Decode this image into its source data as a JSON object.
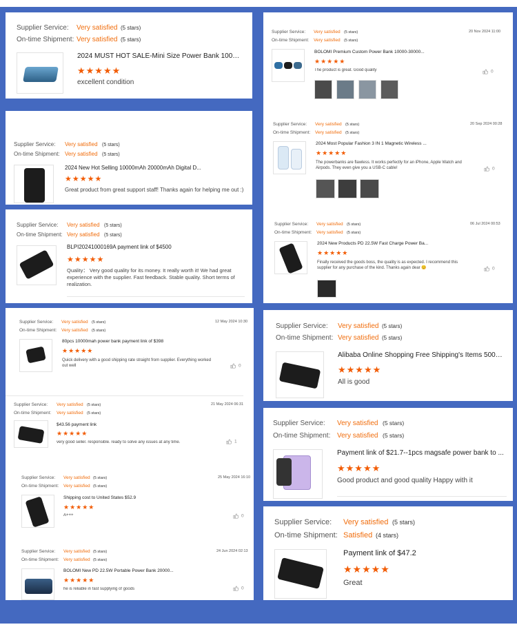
{
  "labels": {
    "supplier": "Supplier Service:",
    "ontime": "On-time Shipment:"
  },
  "colors": {
    "background": "#4469c0",
    "accent": "#f06c0b",
    "star": "#f25c05"
  },
  "reviews": [
    {
      "supplier_val": "Very satisfied",
      "supplier_cnt": "(5 stars)",
      "ontime_val": "Very satisfied",
      "ontime_cnt": "(5 stars)",
      "date": "",
      "product": "2024 MUST HOT SALE-Mini Size Power Bank 10000 ...",
      "rating": 5,
      "text": "excellent condition",
      "likes": ""
    },
    {
      "supplier_val": "Very satisfied",
      "supplier_cnt": "(5 stars)",
      "ontime_val": "Very satisfied",
      "ontime_cnt": "(5 stars)",
      "date": "",
      "product": "2024 New Hot Selling 10000mAh 20000mAh Digital D...",
      "rating": 5,
      "text": "Great product from great support staff! Thanks again for helping me out :)",
      "likes": ""
    },
    {
      "supplier_val": "Very satisfied",
      "supplier_cnt": "(5 stars)",
      "ontime_val": "Very satisfied",
      "ontime_cnt": "(5 stars)",
      "date": "",
      "product": "BLPI20241000169A payment link of $4500",
      "rating": 5,
      "text": "Quality：  Very good quality for its money. It really worth it! We had great experience with the supplier. Fast feedback. Stable quality. Short terms of realization.",
      "likes": ""
    },
    {
      "supplier_val": "Very satisfied",
      "supplier_cnt": "(5 stars)",
      "ontime_val": "Very satisfied",
      "ontime_cnt": "(5 stars)",
      "date": "12 May 2024 10:30",
      "product": "80pcs 10000mah power bank payment link of $398",
      "rating": 5,
      "text": "Quick delivery with a good shipping rate straight from supplier. Everything worked out well",
      "likes": "0"
    },
    {
      "supplier_val": "Very satisfied",
      "supplier_cnt": "(5 stars)",
      "ontime_val": "Very satisfied",
      "ontime_cnt": "(5 stars)",
      "date": "21 May 2024 06:31",
      "product": "$43.56 payment link",
      "rating": 5,
      "text": "very good seller.  responsible.  ready to solve any issues at any time.",
      "likes": "1"
    },
    {
      "supplier_val": "Very satisfied",
      "supplier_cnt": "(5 stars)",
      "ontime_val": "Very satisfied",
      "ontime_cnt": "(5 stars)",
      "date": "25 May 2024 16:10",
      "product": "Shipping cost to United States $52.9",
      "rating": 5,
      "text": "A+++",
      "likes": "0"
    },
    {
      "supplier_val": "Very satisfied",
      "supplier_cnt": "(5 stars)",
      "ontime_val": "Very satisfied",
      "ontime_cnt": "(5 stars)",
      "date": "24 Jun 2024 02:13",
      "product": "BOLOMI New PD 22.5W Portable Power Bank 20000...",
      "rating": 5,
      "text": "he is reliable in fast supplying of goods",
      "likes": "0"
    },
    {
      "supplier_val": "Very satisfied",
      "supplier_cnt": "(5 stars)",
      "ontime_val": "Very satisfied",
      "ontime_cnt": "(5 stars)",
      "date": "20 Nov 2024 11:00",
      "product": "BOLOMI Premium Custom Power Bank 10000-30000...",
      "rating": 5,
      "text": "The product is great. Good quality",
      "likes": "0"
    },
    {
      "supplier_val": "Very satisfied",
      "supplier_cnt": "(5 stars)",
      "ontime_val": "Very satisfied",
      "ontime_cnt": "(5 stars)",
      "date": "20 Sep 2024 00:28",
      "product": "2024 Most Popular Fashion 3 IN 1 Magnetic Wireless ...",
      "rating": 5,
      "text": "The powerbanks are flawless. It works perfectly for an iPhone, Apple Watch and Airpods. They even give you a USB-C cable!",
      "likes": "0"
    },
    {
      "supplier_val": "Very satisfied",
      "supplier_cnt": "(5 stars)",
      "ontime_val": "Very satisfied",
      "ontime_cnt": "(5 stars)",
      "date": "06 Jul 2024 00:53",
      "product": "2024 New Products PD 22.5W Fast Charge Power Ba...",
      "rating": 5,
      "text": "Finally received the goods boss, the quality is as expected. I recommend this supplier for any purchase of the kind. Thanks again dear 😊",
      "likes": "0"
    },
    {
      "supplier_val": "Very satisfied",
      "supplier_cnt": "(5 stars)",
      "ontime_val": "Very satisfied",
      "ontime_cnt": "(5 stars)",
      "date": "",
      "product": "Alibaba Online Shopping Free Shipping's Items 50000...",
      "rating": 5,
      "text": "All is good",
      "likes": ""
    },
    {
      "supplier_val": "Very satisfied",
      "supplier_cnt": "(5 stars)",
      "ontime_val": "Very satisfied",
      "ontime_cnt": "(5 stars)",
      "date": "",
      "product": "Payment link of $21.7--1pcs magsafe power bank to ...",
      "rating": 5,
      "text": "Good product and good quality Happy with it",
      "likes": ""
    },
    {
      "supplier_val": "Very satisfied",
      "supplier_cnt": "(5 stars)",
      "ontime_val": "Satisfied",
      "ontime_cnt": "(4 stars)",
      "date": "",
      "product": "Payment link of $47.2",
      "rating": 5,
      "text": "Great",
      "likes": ""
    }
  ]
}
